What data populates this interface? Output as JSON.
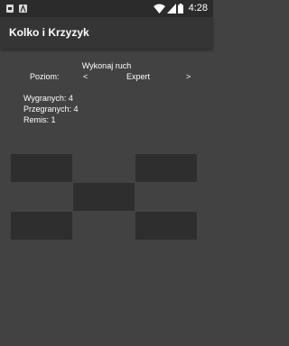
{
  "status_bar": {
    "time": "4:28",
    "left_icons": [
      "android-icon",
      "notification-a-icon"
    ],
    "right_icons": [
      "wifi-icon",
      "signal-icon",
      "battery-icon"
    ]
  },
  "app_bar": {
    "title": "Kolko i Krzyzyk"
  },
  "game": {
    "status": "Wykonaj ruch",
    "level_label": "Poziom:",
    "level_prev": "<",
    "level_value": "Expert",
    "level_next": ">"
  },
  "stats": {
    "wins": "Wygranych: 4",
    "losses": "Przegranych: 4",
    "draws": "Remis: 1"
  },
  "board": {
    "cells": [
      "filled",
      "empty",
      "filled",
      "empty",
      "filled",
      "empty",
      "filled",
      "empty",
      "filled"
    ]
  },
  "colors": {
    "background": "#424242",
    "app_bar": "#353535",
    "status_bar": "#2b2b2b",
    "cell_filled": "#2e2e2e",
    "text": "#ffffff"
  }
}
